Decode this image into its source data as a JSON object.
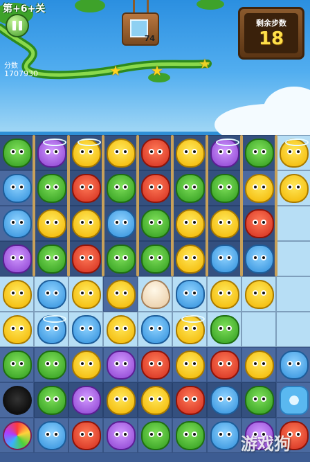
{
  "hud": {
    "level_label": "第+6+关",
    "target_count": "74",
    "moves_label": "剩余步数",
    "moves_value": "18",
    "score_label": "分数",
    "score_value": "1707930",
    "stars_earned": 2,
    "stars_total": 3
  },
  "colors": {
    "sky": "#2b8fe0",
    "board": "#3d5c92",
    "ice": "#b7def5",
    "moves_text": "#ffe04a"
  },
  "board": {
    "rows": 9,
    "cols": 9,
    "tiles": [
      [
        "dark",
        "dark",
        "dark",
        "dark",
        "dark",
        "dark",
        "dark",
        "dark",
        "ice"
      ],
      [
        "mid",
        "dark",
        "dark",
        "dark",
        "dark",
        "dark",
        "dark",
        "mid",
        "ice"
      ],
      [
        "mid",
        "dark",
        "dark",
        "dark",
        "dark",
        "dark",
        "dark",
        "dark",
        "ice"
      ],
      [
        "dark",
        "dark",
        "dark",
        "dark",
        "dark",
        "dark",
        "dark",
        "dark",
        "ice"
      ],
      [
        "ice",
        "ice",
        "ice",
        "mid",
        "ice",
        "ice",
        "ice",
        "ice",
        "ice"
      ],
      [
        "ice",
        "ice",
        "ice",
        "ice",
        "ice",
        "ice",
        "ice",
        "ice",
        "ice"
      ],
      [
        "mid",
        "mid",
        "mid",
        "mid",
        "mid",
        "mid",
        "mid",
        "mid",
        "mid"
      ],
      [
        "mid",
        "dark",
        "dark",
        "dark",
        "dark",
        "dark",
        "dark",
        "dark",
        "mid"
      ],
      [
        "mid",
        "mid",
        "mid",
        "mid",
        "mid",
        "mid",
        "mid",
        "mid",
        "mid"
      ]
    ],
    "pieces": [
      [
        "frog",
        "owl",
        "chick",
        "chick",
        "fox",
        "chick",
        "owl",
        "frog",
        "chick"
      ],
      [
        "bear",
        "frog",
        "fox",
        "frog",
        "fox",
        "frog",
        "frog",
        "chick",
        "chick"
      ],
      [
        "bear",
        "chick",
        "chick",
        "bear",
        "frog",
        "chick",
        "chick",
        "fox",
        ""
      ],
      [
        "owl",
        "frog",
        "fox",
        "frog",
        "frog",
        "chick",
        "bear",
        "bear",
        ""
      ],
      [
        "chick",
        "bear",
        "chick",
        "chick",
        "egg",
        "bear",
        "chick",
        "chick",
        ""
      ],
      [
        "chick",
        "bear",
        "bear",
        "chick",
        "bear",
        "chick",
        "frog",
        "",
        ""
      ],
      [
        "frog",
        "frog",
        "chick",
        "owl",
        "fox",
        "chick",
        "fox",
        "chick",
        "bear"
      ],
      [
        "soot",
        "frog",
        "owl",
        "chick",
        "chick",
        "fox",
        "bear",
        "frog",
        "flower"
      ],
      [
        "rainbow",
        "bear",
        "fox",
        "owl",
        "frog",
        "frog",
        "bear",
        "owl",
        "fox"
      ]
    ],
    "halos": [
      [
        0,
        1
      ],
      [
        0,
        2
      ],
      [
        0,
        6
      ],
      [
        0,
        8
      ],
      [
        5,
        1
      ],
      [
        5,
        5
      ]
    ]
  },
  "watermark": "游戏狗"
}
